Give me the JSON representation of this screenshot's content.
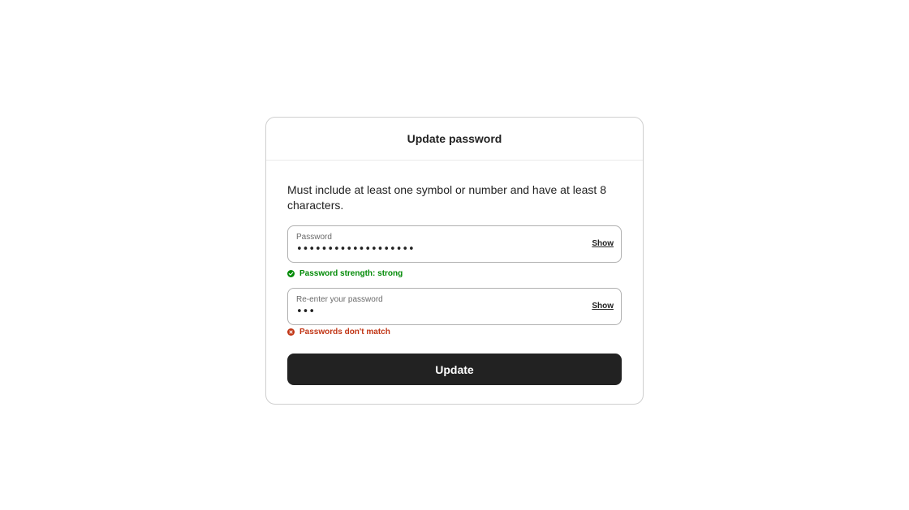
{
  "dialog": {
    "title": "Update password",
    "instructions": "Must include at least one symbol or number and have at least 8 characters."
  },
  "password_field": {
    "label": "Password",
    "value": "•••••••••••••••••••",
    "show_label": "Show"
  },
  "strength_hint": {
    "icon": "check-circle-icon",
    "text": "Password strength: strong",
    "color": "#008a05"
  },
  "confirm_field": {
    "label": "Re-enter your password",
    "value": "•••",
    "show_label": "Show"
  },
  "match_error": {
    "icon": "x-circle-icon",
    "text": "Passwords don't match",
    "color": "#c13515"
  },
  "update_button": {
    "label": "Update"
  }
}
